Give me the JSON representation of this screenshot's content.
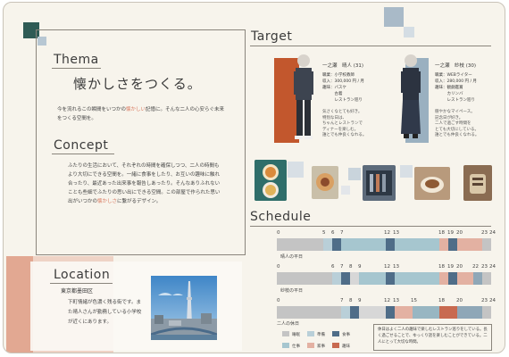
{
  "thema": {
    "heading": "Thema",
    "title": "懐かしさをつくる。",
    "body_pre": "今を流れるこの瞬間をいつかの",
    "body_hl": "懐かしい",
    "body_post": "記憶に。そんな二人の心安らぐ未来をつくる空間を。"
  },
  "concept": {
    "heading": "Concept",
    "body_pre": "ふたりの生活において、それぞれの時間を確保しつつ、二人の時間もより大切にできる空間を。一緒に食事をしたり、お互いの趣味に触れ合ったり、最近あった出来事を報告しあったり。そんなありふれないことも些細でふたりの思い出にできる空間。この部屋で作られた思い出がいつかの",
    "body_hl": "懐かしさ",
    "body_post": "に繋がるデザイン。"
  },
  "target": {
    "heading": "Target",
    "persons": [
      {
        "name": "一之瀬　晴人 (31)",
        "lines": [
          "職業：小学校教師",
          "収入：300,000 円 / 月",
          "趣味：バスケ",
          "　　　古着",
          "　　　レストラン巡り"
        ],
        "extra": [
          "気さくなとても好き。",
          "特別な日は、",
          "ちゃんとレストランで",
          "ディナーを楽しむ。",
          "誰とでも仲良くなれる。"
        ]
      },
      {
        "name": "一之瀬　紗枝 (30)",
        "lines": [
          "職業：WEBライター",
          "収入：280,000 円 / 月",
          "趣味：観劇鑑賞",
          "　　　カリンバ",
          "　　　レストラン巡り"
        ],
        "extra": [
          "穏やかなマイペース。",
          "記念日が好き。",
          "二人で過ごす時間を",
          "とても大切にしている。",
          "誰とでも仲良くなれる。"
        ]
      }
    ]
  },
  "schedule": {
    "heading": "Schedule",
    "rows": [
      {
        "label": "晴人の平日",
        "ticks": [
          "0",
          "5",
          "6",
          "7",
          "12",
          "13",
          "18",
          "19",
          "20",
          "23",
          "24"
        ]
      },
      {
        "label": "紗枝の平日",
        "ticks": [
          "0",
          "6",
          "7",
          "8",
          "9",
          "12",
          "13",
          "18",
          "19",
          "20",
          "22",
          "23",
          "24"
        ]
      },
      {
        "label": "二人の休日",
        "ticks": [
          "0",
          "7",
          "8",
          "9",
          "12",
          "13",
          "15",
          "18",
          "20",
          "23",
          "24"
        ]
      }
    ],
    "legend": [
      "睡眠",
      "準備",
      "食事",
      "仕事",
      "家事",
      "趣味",
      "外出",
      "その他",
      "自由"
    ],
    "legend_colors": [
      "#c4c4c4",
      "#b9cfd8",
      "#4f6d88",
      "#a6c6cf",
      "#e3b1a2",
      "#c86a50",
      "#98b6c2",
      "#d7d7d7",
      "#8fa7b7"
    ],
    "note": "休日はよく二人の趣味で楽しむレストラン巡りをしている。長く過ごせることで、ゆっくり話を楽しむことができている。二人にとって大切な時間。"
  },
  "location": {
    "heading": "Location",
    "area": "東京都墨田区",
    "body": "下町情緒が色濃く残る街です。また晴人さんが勤務している小学校が近くにあります。"
  },
  "colors": {
    "accent": "#d9785e",
    "dark_teal": "#2f5b55",
    "steel": "#9ab0c0",
    "rust": "#c2572d"
  }
}
